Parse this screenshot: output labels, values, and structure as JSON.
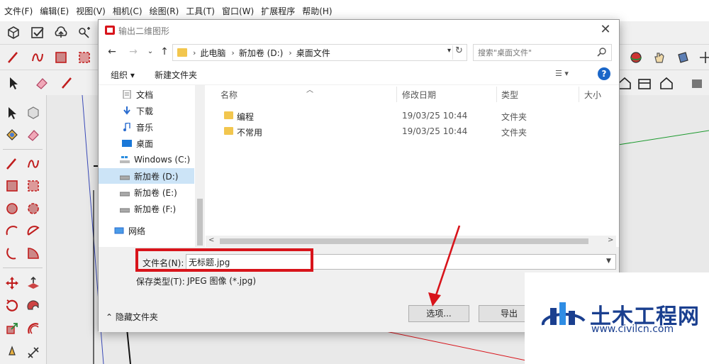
{
  "menubar": [
    "文件(F)",
    "编辑(E)",
    "视图(V)",
    "相机(C)",
    "绘图(R)",
    "工具(T)",
    "窗口(W)",
    "扩展程序",
    "帮助(H)"
  ],
  "dialog": {
    "title": "输出二维图形",
    "breadcrumbs": [
      "此电脑",
      "新加卷 (D:)",
      "桌面文件"
    ],
    "search_placeholder": "搜索\"桌面文件\"",
    "organize_label": "组织 ▾",
    "new_folder_label": "新建文件夹",
    "help_label": "?",
    "nav_items": [
      {
        "label": "文档",
        "icon": "document-icon"
      },
      {
        "label": "下载",
        "icon": "download-icon"
      },
      {
        "label": "音乐",
        "icon": "music-icon"
      },
      {
        "label": "桌面",
        "icon": "desktop-icon"
      },
      {
        "label": "Windows (C:)",
        "icon": "windows-drive-icon"
      },
      {
        "label": "新加卷 (D:)",
        "icon": "drive-icon",
        "selected": true
      },
      {
        "label": "新加卷 (E:)",
        "icon": "drive-icon"
      },
      {
        "label": "新加卷 (F:)",
        "icon": "drive-icon"
      },
      {
        "label": "网络",
        "icon": "network-icon"
      }
    ],
    "columns": {
      "name": "名称",
      "date": "修改日期",
      "type": "类型",
      "size": "大小"
    },
    "files": [
      {
        "name": "编程",
        "date": "19/03/25 10:44",
        "type": "文件夹"
      },
      {
        "name": "不常用",
        "date": "19/03/25 10:44",
        "type": "文件夹"
      }
    ],
    "filename_label": "文件名(N):",
    "filename_value": "无标题.jpg",
    "filetype_label": "保存类型(T):",
    "filetype_value": "JPEG 图像 (*.jpg)",
    "hide_folders_label": "隐藏文件夹",
    "options_button": "选项...",
    "export_button": "导出"
  },
  "watermark": {
    "name": "土木工程网",
    "url": "www.civilcn.com"
  },
  "colors": {
    "highlight": "#d8141b",
    "folder": "#f2c64e",
    "accent": "#1a66c8",
    "watermark": "#1a3f8f"
  }
}
